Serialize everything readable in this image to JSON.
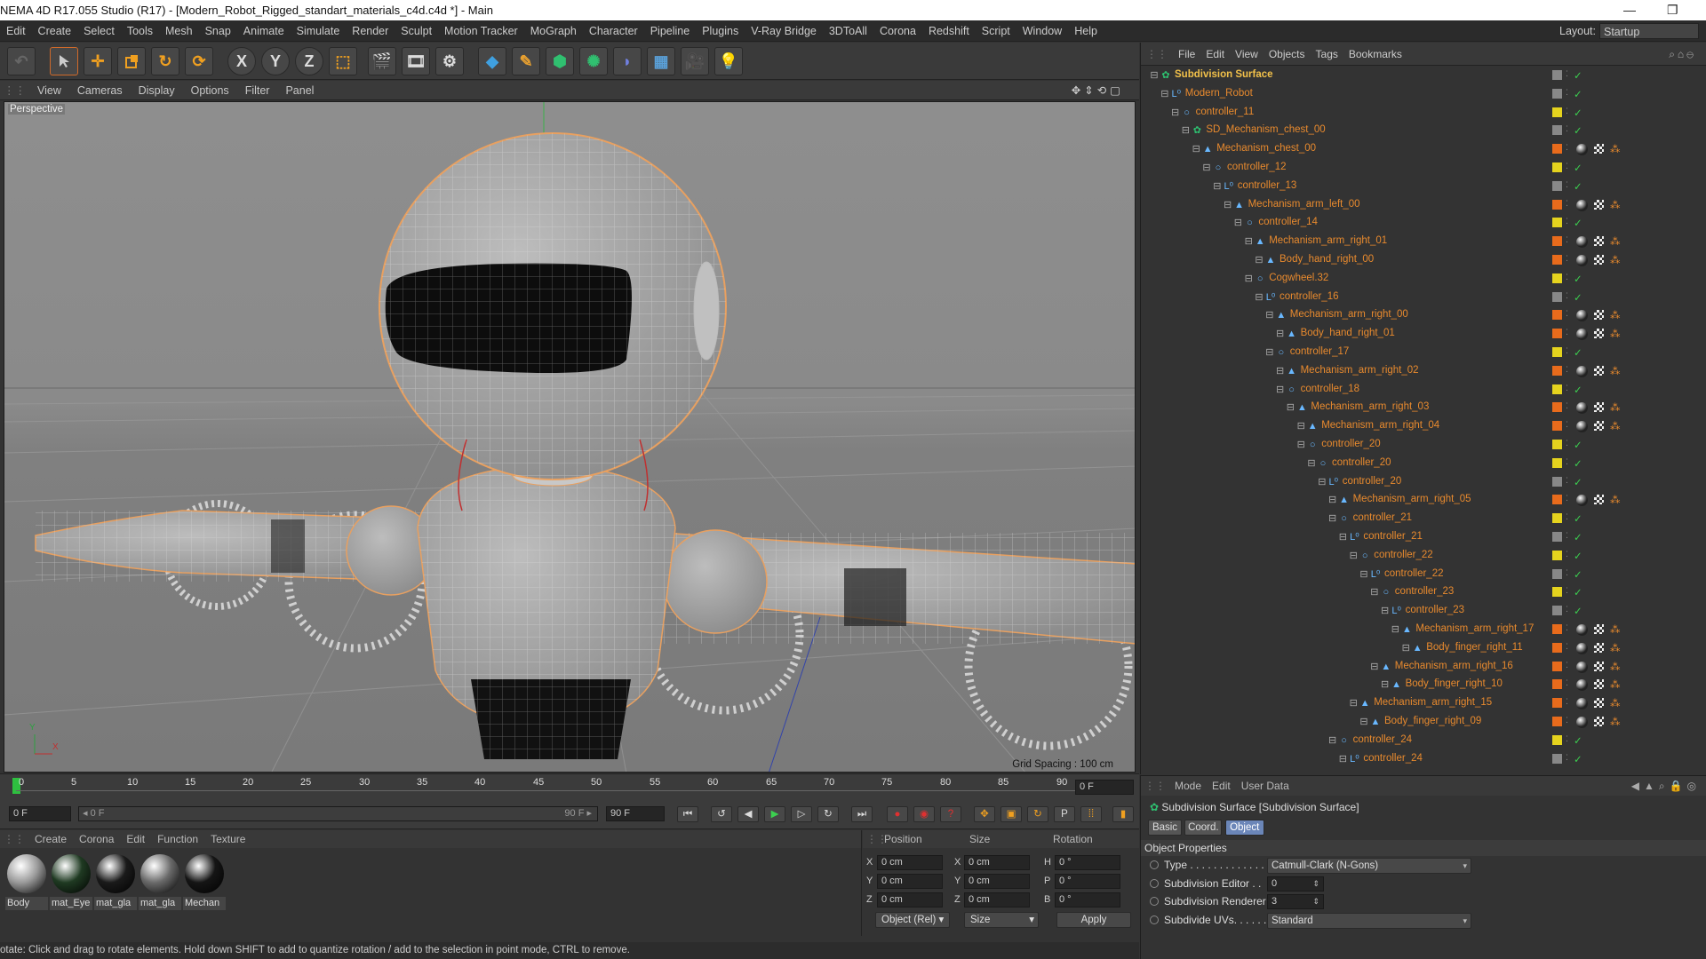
{
  "window": {
    "title": "NEMA 4D R17.055 Studio (R17) - [Modern_Robot_Rigged_standart_materials_c4d.c4d *] - Main",
    "controls": [
      "—",
      "❐"
    ]
  },
  "menubar": {
    "items": [
      "Edit",
      "Create",
      "Select",
      "Tools",
      "Mesh",
      "Snap",
      "Animate",
      "Simulate",
      "Render",
      "Sculpt",
      "Motion Tracker",
      "MoGraph",
      "Character",
      "Pipeline",
      "Plugins",
      "V-Ray Bridge",
      "3DToAll",
      "Corona",
      "Redshift",
      "Script",
      "Window",
      "Help"
    ],
    "layout_label": "Layout:",
    "layout_value": "Startup"
  },
  "toolbar": {
    "axis_x": "X",
    "axis_y": "Y",
    "axis_z": "Z"
  },
  "viewport": {
    "menu": [
      "View",
      "Cameras",
      "Display",
      "Options",
      "Filter",
      "Panel"
    ],
    "label": "Perspective",
    "grid_spacing": "Grid Spacing : 100 cm",
    "axis_y": "Y",
    "axis_x": "X"
  },
  "timeline": {
    "ticks": [
      "0",
      "5",
      "10",
      "15",
      "20",
      "25",
      "30",
      "35",
      "40",
      "45",
      "50",
      "55",
      "60",
      "65",
      "70",
      "75",
      "80",
      "85",
      "90"
    ],
    "current_frame": "0 F"
  },
  "transport": {
    "start_frame": "0 F",
    "range_start": "◂ 0 F",
    "range_end": "90 F ▸",
    "end_frame": "90 F"
  },
  "materials": {
    "menu": [
      "Create",
      "Corona",
      "Edit",
      "Function",
      "Texture"
    ],
    "items": [
      {
        "name": "Body",
        "color": "#9a9a9a"
      },
      {
        "name": "mat_Eye",
        "color": "#1f3a22"
      },
      {
        "name": "mat_gla",
        "color": "#1a1a1a"
      },
      {
        "name": "mat_gla",
        "color": "#6a6a6a"
      },
      {
        "name": "Mechan",
        "color": "#151515"
      }
    ]
  },
  "coordinates": {
    "headers": [
      "Position",
      "Size",
      "Rotation"
    ],
    "rows": [
      {
        "axis": "X",
        "pos": "0 cm",
        "size_axis": "X",
        "size": "0 cm",
        "rot_axis": "H",
        "rot": "0 °"
      },
      {
        "axis": "Y",
        "pos": "0 cm",
        "size_axis": "Y",
        "size": "0 cm",
        "rot_axis": "P",
        "rot": "0 °"
      },
      {
        "axis": "Z",
        "pos": "0 cm",
        "size_axis": "Z",
        "size": "0 cm",
        "rot_axis": "B",
        "rot": "0 °"
      }
    ],
    "mode_select": "Object (Rel)",
    "size_select": "Size",
    "apply": "Apply"
  },
  "status": "otate: Click and drag to rotate elements. Hold down SHIFT to add to quantize rotation / add to the selection in point mode, CTRL to remove.",
  "objects": {
    "menu": [
      "File",
      "Edit",
      "View",
      "Objects",
      "Tags",
      "Bookmarks"
    ],
    "tree": [
      {
        "name": "Subdivision Surface",
        "depth": 0,
        "icon": "✿",
        "swatch": "#888888",
        "tags": 0,
        "highlight": true
      },
      {
        "name": "Modern_Robot",
        "depth": 1,
        "icon": "L⁰",
        "swatch": "#888888",
        "tags": 0
      },
      {
        "name": "controller_11",
        "depth": 2,
        "icon": "○",
        "swatch": "#e5d31e",
        "tags": 0
      },
      {
        "name": "SD_Mechanism_chest_00",
        "depth": 3,
        "icon": "✿",
        "swatch": "#888888",
        "tags": 0
      },
      {
        "name": "Mechanism_chest_00",
        "depth": 4,
        "icon": "▲",
        "swatch": "#e86b1c",
        "tags": 3
      },
      {
        "name": "controller_12",
        "depth": 5,
        "icon": "○",
        "swatch": "#e5d31e",
        "tags": 0
      },
      {
        "name": "controller_13",
        "depth": 6,
        "icon": "L⁰",
        "swatch": "#888888",
        "tags": 0
      },
      {
        "name": "Mechanism_arm_left_00",
        "depth": 7,
        "icon": "▲",
        "swatch": "#e86b1c",
        "tags": 3
      },
      {
        "name": "controller_14",
        "depth": 8,
        "icon": "○",
        "swatch": "#e5d31e",
        "tags": 0
      },
      {
        "name": "Mechanism_arm_right_01",
        "depth": 9,
        "icon": "▲",
        "swatch": "#e86b1c",
        "tags": 3
      },
      {
        "name": "Body_hand_right_00",
        "depth": 10,
        "icon": "▲",
        "swatch": "#e86b1c",
        "tags": 3
      },
      {
        "name": "Cogwheel.32",
        "depth": 9,
        "icon": "○",
        "swatch": "#e5d31e",
        "tags": 0
      },
      {
        "name": "controller_16",
        "depth": 10,
        "icon": "L⁰",
        "swatch": "#888888",
        "tags": 0
      },
      {
        "name": "Mechanism_arm_right_00",
        "depth": 11,
        "icon": "▲",
        "swatch": "#e86b1c",
        "tags": 3
      },
      {
        "name": "Body_hand_right_01",
        "depth": 12,
        "icon": "▲",
        "swatch": "#e86b1c",
        "tags": 3
      },
      {
        "name": "controller_17",
        "depth": 11,
        "icon": "○",
        "swatch": "#e5d31e",
        "tags": 0
      },
      {
        "name": "Mechanism_arm_right_02",
        "depth": 12,
        "icon": "▲",
        "swatch": "#e86b1c",
        "tags": 3
      },
      {
        "name": "controller_18",
        "depth": 12,
        "icon": "○",
        "swatch": "#e5d31e",
        "tags": 0
      },
      {
        "name": "Mechanism_arm_right_03",
        "depth": 13,
        "icon": "▲",
        "swatch": "#e86b1c",
        "tags": 3
      },
      {
        "name": "Mechanism_arm_right_04",
        "depth": 14,
        "icon": "▲",
        "swatch": "#e86b1c",
        "tags": 3
      },
      {
        "name": "controller_20",
        "depth": 14,
        "icon": "○",
        "swatch": "#e5d31e",
        "tags": 0
      },
      {
        "name": "controller_20",
        "depth": 15,
        "icon": "○",
        "swatch": "#e5d31e",
        "tags": 0
      },
      {
        "name": "controller_20",
        "depth": 16,
        "icon": "L⁰",
        "swatch": "#888888",
        "tags": 0
      },
      {
        "name": "Mechanism_arm_right_05",
        "depth": 17,
        "icon": "▲",
        "swatch": "#e86b1c",
        "tags": 3
      },
      {
        "name": "controller_21",
        "depth": 17,
        "icon": "○",
        "swatch": "#e5d31e",
        "tags": 0
      },
      {
        "name": "controller_21",
        "depth": 18,
        "icon": "L⁰",
        "swatch": "#888888",
        "tags": 0
      },
      {
        "name": "controller_22",
        "depth": 19,
        "icon": "○",
        "swatch": "#e5d31e",
        "tags": 0
      },
      {
        "name": "controller_22",
        "depth": 20,
        "icon": "L⁰",
        "swatch": "#888888",
        "tags": 0
      },
      {
        "name": "controller_23",
        "depth": 21,
        "icon": "○",
        "swatch": "#e5d31e",
        "tags": 0
      },
      {
        "name": "controller_23",
        "depth": 22,
        "icon": "L⁰",
        "swatch": "#888888",
        "tags": 0
      },
      {
        "name": "Mechanism_arm_right_17",
        "depth": 23,
        "icon": "▲",
        "swatch": "#e86b1c",
        "tags": 3
      },
      {
        "name": "Body_finger_right_11",
        "depth": 24,
        "icon": "▲",
        "swatch": "#e86b1c",
        "tags": 3
      },
      {
        "name": "Mechanism_arm_right_16",
        "depth": 21,
        "icon": "▲",
        "swatch": "#e86b1c",
        "tags": 3
      },
      {
        "name": "Body_finger_right_10",
        "depth": 22,
        "icon": "▲",
        "swatch": "#e86b1c",
        "tags": 3
      },
      {
        "name": "Mechanism_arm_right_15",
        "depth": 19,
        "icon": "▲",
        "swatch": "#e86b1c",
        "tags": 3
      },
      {
        "name": "Body_finger_right_09",
        "depth": 20,
        "icon": "▲",
        "swatch": "#e86b1c",
        "tags": 3
      },
      {
        "name": "controller_24",
        "depth": 17,
        "icon": "○",
        "swatch": "#e5d31e",
        "tags": 0
      },
      {
        "name": "controller_24",
        "depth": 18,
        "icon": "L⁰",
        "swatch": "#888888",
        "tags": 0
      }
    ]
  },
  "attributes": {
    "menu": [
      "Mode",
      "Edit",
      "User Data"
    ],
    "object_title": "Subdivision Surface [Subdivision Surface]",
    "tabs": [
      "Basic",
      "Coord.",
      "Object"
    ],
    "active_tab": "Object",
    "section": "Object Properties",
    "props": [
      {
        "label": "Type . . . . . . . . . . . . . .",
        "value": "Catmull-Clark (N-Gons)",
        "kind": "select"
      },
      {
        "label": "Subdivision Editor . .",
        "value": "0",
        "kind": "number"
      },
      {
        "label": "Subdivision Renderer",
        "value": "3",
        "kind": "number"
      },
      {
        "label": "Subdivide UVs. . . . . . .",
        "value": "Standard",
        "kind": "select"
      }
    ]
  },
  "colors": {
    "accent_orange": "#e88a2e",
    "accent_yellow": "#e5d31e",
    "ui_dark": "#333333",
    "viewport_bg": "#8a8a8a"
  }
}
